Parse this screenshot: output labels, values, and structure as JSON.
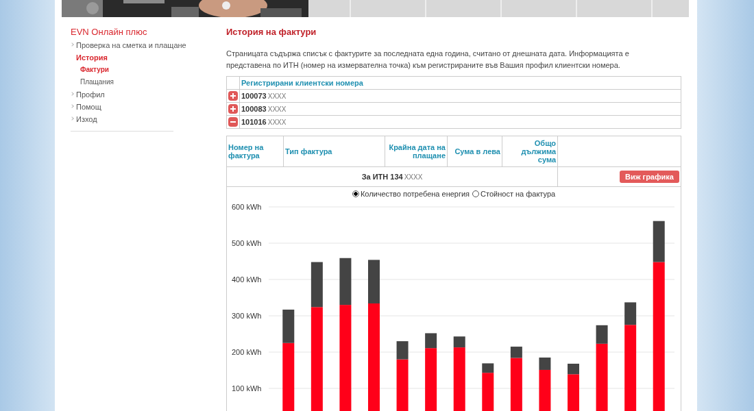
{
  "sidebar": {
    "title": "EVN Онлайн плюс",
    "items": [
      {
        "label": "Проверка на сметка и плащане",
        "selected": false
      },
      {
        "label": "История",
        "selected": true,
        "children": [
          {
            "label": "Фактури",
            "selected": true
          },
          {
            "label": "Плащания",
            "selected": false
          }
        ]
      },
      {
        "label": "Профил",
        "selected": false
      },
      {
        "label": "Помощ",
        "selected": false
      },
      {
        "label": "Изход",
        "selected": false
      }
    ]
  },
  "main": {
    "title": "История на фактури",
    "intro": "Страницата съдържа списък с фактурите за последната една година, считано от днешната дата. Информацията е представена по ИТН (номер на измервателна точка) към регистрираните във Вашия профил клиентски номера.",
    "clients": {
      "heading": "Регистрирани клиентски номера",
      "rows": [
        {
          "number": "100073",
          "masked": "XXXX",
          "expanded": false
        },
        {
          "number": "100083",
          "masked": "XXXX",
          "expanded": false
        },
        {
          "number": "101016",
          "masked": "XXXX",
          "expanded": true
        }
      ]
    },
    "invoices": {
      "columns": [
        "Номер на фактура",
        "Тип фактура",
        "Крайна дата на плащане",
        "Сума в лева",
        "Общо дължима сума"
      ],
      "itn_label": "За ИТН 134",
      "itn_masked": "XXXX",
      "chart_button": "Виж графика",
      "radios": [
        {
          "label": "Количество потребена енергия",
          "selected": true
        },
        {
          "label": "Стойност на фактура",
          "selected": false
        }
      ],
      "chart_data": {
        "type": "bar",
        "stacked": true,
        "grid": true,
        "ylim": [
          0,
          600
        ],
        "yticks": [
          {
            "value": 100,
            "label": "100 kWh"
          },
          {
            "value": 200,
            "label": "200 kWh"
          },
          {
            "value": 300,
            "label": "300 kWh"
          },
          {
            "value": 400,
            "label": "400 kWh"
          },
          {
            "value": 500,
            "label": "500 kWh"
          },
          {
            "value": 600,
            "label": "600 kWh"
          }
        ],
        "series": [
          {
            "color": "#ff0019",
            "values": [
              225,
              324,
              330,
              334,
              180,
              211,
              213,
              143,
              184,
              151,
              139,
              223,
              275,
              448
            ]
          },
          {
            "color": "#444444",
            "values": [
              92,
              124,
              129,
              120,
              50,
              41,
              30,
              26,
              31,
              34,
              29,
              51,
              62,
              113
            ]
          }
        ]
      }
    }
  }
}
